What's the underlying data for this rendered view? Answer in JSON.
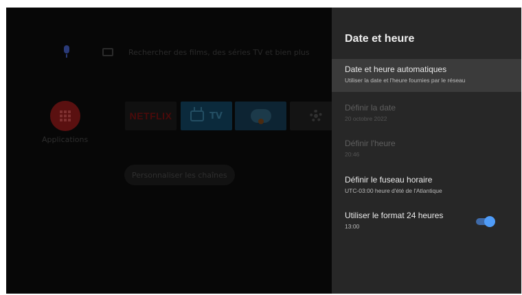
{
  "home": {
    "search_hint": "Rechercher des films, des séries TV et bien plus",
    "apps_label": "Applications",
    "tiles": {
      "netflix": "NETFLIX",
      "tv": "TV"
    },
    "customize_channels": "Personnaliser les chaînes"
  },
  "panel": {
    "title": "Date et heure",
    "items": [
      {
        "title": "Date et heure automatiques",
        "subtitle": "Utiliser la date et l'heure fournies par le réseau",
        "state": "focused"
      },
      {
        "title": "Définir la date",
        "subtitle": "20 octobre 2022",
        "state": "disabled"
      },
      {
        "title": "Définir l'heure",
        "subtitle": "20:46",
        "state": "disabled"
      },
      {
        "title": "Définir le fuseau horaire",
        "subtitle": "UTC-03:00 heure d'été de l'Atlantique",
        "state": "enabled"
      },
      {
        "title": "Utiliser le format 24 heures",
        "subtitle": "13:00",
        "state": "enabled",
        "toggle_on": true
      }
    ]
  },
  "colors": {
    "accent": "#4f9cf8",
    "panel_bg": "#272727",
    "focus_bg": "#3b3b3b"
  }
}
